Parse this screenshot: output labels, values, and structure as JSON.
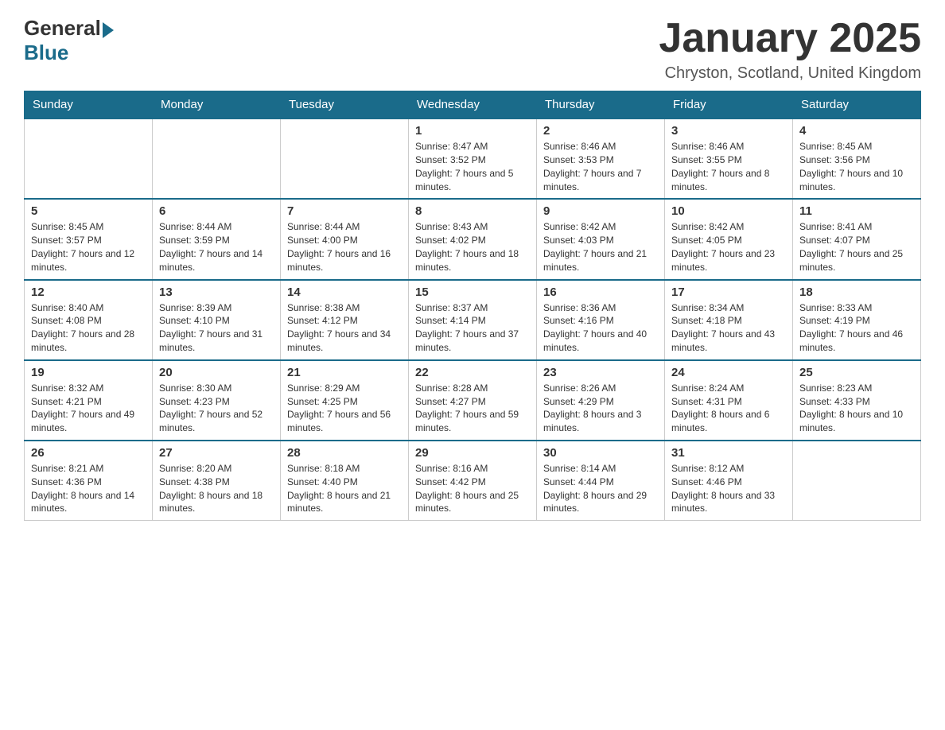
{
  "header": {
    "logo_general": "General",
    "logo_blue": "Blue",
    "title": "January 2025",
    "subtitle": "Chryston, Scotland, United Kingdom"
  },
  "days_of_week": [
    "Sunday",
    "Monday",
    "Tuesday",
    "Wednesday",
    "Thursday",
    "Friday",
    "Saturday"
  ],
  "weeks": [
    [
      {
        "day": "",
        "info": ""
      },
      {
        "day": "",
        "info": ""
      },
      {
        "day": "",
        "info": ""
      },
      {
        "day": "1",
        "info": "Sunrise: 8:47 AM\nSunset: 3:52 PM\nDaylight: 7 hours and 5 minutes."
      },
      {
        "day": "2",
        "info": "Sunrise: 8:46 AM\nSunset: 3:53 PM\nDaylight: 7 hours and 7 minutes."
      },
      {
        "day": "3",
        "info": "Sunrise: 8:46 AM\nSunset: 3:55 PM\nDaylight: 7 hours and 8 minutes."
      },
      {
        "day": "4",
        "info": "Sunrise: 8:45 AM\nSunset: 3:56 PM\nDaylight: 7 hours and 10 minutes."
      }
    ],
    [
      {
        "day": "5",
        "info": "Sunrise: 8:45 AM\nSunset: 3:57 PM\nDaylight: 7 hours and 12 minutes."
      },
      {
        "day": "6",
        "info": "Sunrise: 8:44 AM\nSunset: 3:59 PM\nDaylight: 7 hours and 14 minutes."
      },
      {
        "day": "7",
        "info": "Sunrise: 8:44 AM\nSunset: 4:00 PM\nDaylight: 7 hours and 16 minutes."
      },
      {
        "day": "8",
        "info": "Sunrise: 8:43 AM\nSunset: 4:02 PM\nDaylight: 7 hours and 18 minutes."
      },
      {
        "day": "9",
        "info": "Sunrise: 8:42 AM\nSunset: 4:03 PM\nDaylight: 7 hours and 21 minutes."
      },
      {
        "day": "10",
        "info": "Sunrise: 8:42 AM\nSunset: 4:05 PM\nDaylight: 7 hours and 23 minutes."
      },
      {
        "day": "11",
        "info": "Sunrise: 8:41 AM\nSunset: 4:07 PM\nDaylight: 7 hours and 25 minutes."
      }
    ],
    [
      {
        "day": "12",
        "info": "Sunrise: 8:40 AM\nSunset: 4:08 PM\nDaylight: 7 hours and 28 minutes."
      },
      {
        "day": "13",
        "info": "Sunrise: 8:39 AM\nSunset: 4:10 PM\nDaylight: 7 hours and 31 minutes."
      },
      {
        "day": "14",
        "info": "Sunrise: 8:38 AM\nSunset: 4:12 PM\nDaylight: 7 hours and 34 minutes."
      },
      {
        "day": "15",
        "info": "Sunrise: 8:37 AM\nSunset: 4:14 PM\nDaylight: 7 hours and 37 minutes."
      },
      {
        "day": "16",
        "info": "Sunrise: 8:36 AM\nSunset: 4:16 PM\nDaylight: 7 hours and 40 minutes."
      },
      {
        "day": "17",
        "info": "Sunrise: 8:34 AM\nSunset: 4:18 PM\nDaylight: 7 hours and 43 minutes."
      },
      {
        "day": "18",
        "info": "Sunrise: 8:33 AM\nSunset: 4:19 PM\nDaylight: 7 hours and 46 minutes."
      }
    ],
    [
      {
        "day": "19",
        "info": "Sunrise: 8:32 AM\nSunset: 4:21 PM\nDaylight: 7 hours and 49 minutes."
      },
      {
        "day": "20",
        "info": "Sunrise: 8:30 AM\nSunset: 4:23 PM\nDaylight: 7 hours and 52 minutes."
      },
      {
        "day": "21",
        "info": "Sunrise: 8:29 AM\nSunset: 4:25 PM\nDaylight: 7 hours and 56 minutes."
      },
      {
        "day": "22",
        "info": "Sunrise: 8:28 AM\nSunset: 4:27 PM\nDaylight: 7 hours and 59 minutes."
      },
      {
        "day": "23",
        "info": "Sunrise: 8:26 AM\nSunset: 4:29 PM\nDaylight: 8 hours and 3 minutes."
      },
      {
        "day": "24",
        "info": "Sunrise: 8:24 AM\nSunset: 4:31 PM\nDaylight: 8 hours and 6 minutes."
      },
      {
        "day": "25",
        "info": "Sunrise: 8:23 AM\nSunset: 4:33 PM\nDaylight: 8 hours and 10 minutes."
      }
    ],
    [
      {
        "day": "26",
        "info": "Sunrise: 8:21 AM\nSunset: 4:36 PM\nDaylight: 8 hours and 14 minutes."
      },
      {
        "day": "27",
        "info": "Sunrise: 8:20 AM\nSunset: 4:38 PM\nDaylight: 8 hours and 18 minutes."
      },
      {
        "day": "28",
        "info": "Sunrise: 8:18 AM\nSunset: 4:40 PM\nDaylight: 8 hours and 21 minutes."
      },
      {
        "day": "29",
        "info": "Sunrise: 8:16 AM\nSunset: 4:42 PM\nDaylight: 8 hours and 25 minutes."
      },
      {
        "day": "30",
        "info": "Sunrise: 8:14 AM\nSunset: 4:44 PM\nDaylight: 8 hours and 29 minutes."
      },
      {
        "day": "31",
        "info": "Sunrise: 8:12 AM\nSunset: 4:46 PM\nDaylight: 8 hours and 33 minutes."
      },
      {
        "day": "",
        "info": ""
      }
    ]
  ]
}
